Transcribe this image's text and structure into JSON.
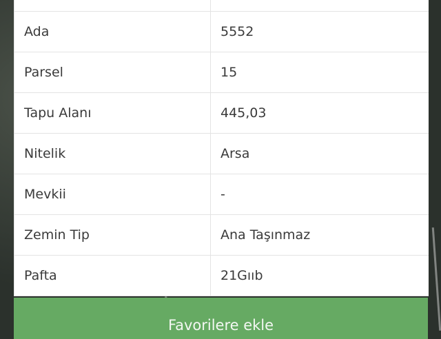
{
  "parcel_info": {
    "rows": [
      {
        "label": "",
        "value": ""
      },
      {
        "label": "Ada",
        "value": "5552"
      },
      {
        "label": "Parsel",
        "value": "15"
      },
      {
        "label": "Tapu Alanı",
        "value": "445,03"
      },
      {
        "label": "Nitelik",
        "value": "Arsa"
      },
      {
        "label": "Mevkii",
        "value": "-"
      },
      {
        "label": "Zemin Tip",
        "value": "Ana Taşınmaz"
      },
      {
        "label": "Pafta",
        "value": "21Gııb"
      }
    ]
  },
  "actions": {
    "favorite_label": "Favorilere ekle"
  },
  "colors": {
    "button_green": "#66aa63",
    "panel_bg": "#ffffff"
  }
}
